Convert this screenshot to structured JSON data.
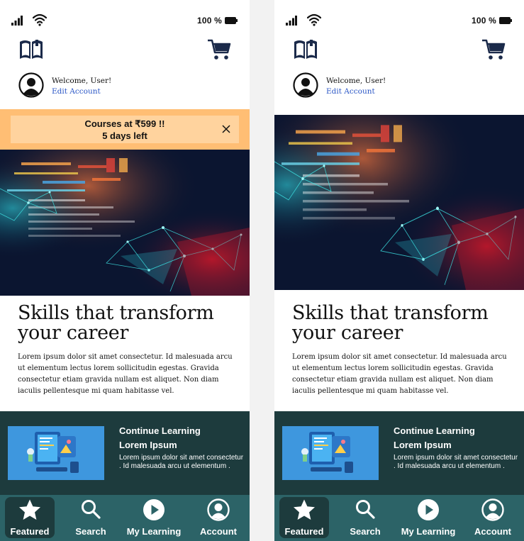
{
  "status_bar": {
    "battery_text": "100 %"
  },
  "profile": {
    "welcome": "Welcome, User!",
    "edit_account": "Edit Account"
  },
  "promo": {
    "line1": "Courses at ₹599 !!",
    "line2": "5 days left"
  },
  "hero": {
    "headline_line1": "Skills that transform",
    "headline_line2": "your career",
    "body": "Lorem ipsum dolor sit amet consectetur. Id malesuada arcu ut elementum lectus lorem sollicitudin egestas. Gravida consectetur etiam gravida nullam est aliquet. Non diam iaculis pellentesque mi quam habitasse vel."
  },
  "continue_learning": {
    "title": "Continue Learning",
    "subtitle": "Lorem Ipsum",
    "description": "Lorem ipsum dolor sit amet consectetur . Id malesuada arcu ut elementum ."
  },
  "nav": {
    "featured": "Featured",
    "search": "Search",
    "my_learning": "My Learning",
    "account": "Account"
  },
  "icons": {
    "logo": "book-icon",
    "cart": "cart-icon",
    "avatar": "user-circle-icon",
    "close": "close-icon",
    "featured": "star-icon",
    "search": "search-icon",
    "my_learning": "play-icon",
    "account": "account-icon"
  },
  "colors": {
    "brand_dark": "#1b2a4a",
    "promo_outer": "#ffbe74",
    "promo_inner": "#ffd39e",
    "continue_bg": "#1d3b3d",
    "nav_bg": "#2c6367",
    "link": "#2a56c6"
  }
}
